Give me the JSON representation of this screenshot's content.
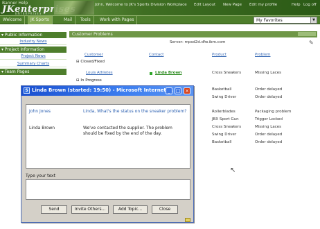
{
  "banner": {
    "logo_top": "Banner Help",
    "logo": "JKenterprises",
    "logo_sub": "ENTERPRISES",
    "welcome": "John, Welcome to JK's Sports Division Workplace",
    "links": [
      "Edit Layout",
      "New Page",
      "Edit my profile",
      "Help",
      "Log off"
    ]
  },
  "nav": {
    "tabs": [
      "Welcome",
      "JK Sports",
      "Mail",
      "Tools",
      "Work with Pages"
    ],
    "active_index": 1,
    "favorites": "My Favorites"
  },
  "sidebar": {
    "sections": [
      {
        "title": "Public Information",
        "items": [
          "Industry News"
        ]
      },
      {
        "title": "Project Information",
        "items": [
          "Project News",
          "Summary Charts"
        ]
      },
      {
        "title": "Team Pages",
        "items": []
      }
    ]
  },
  "main": {
    "title": "Customer Problems",
    "server": "Server: mpsd2d.dfw.ibm.com",
    "columns": [
      "Customer",
      "Contact",
      "Product",
      "Problem"
    ],
    "groups": {
      "closed": "Closed/Fixed",
      "progress": "In Progress"
    },
    "rows": [
      {
        "customer": "Louis Athletes",
        "contact": "Linda Brown",
        "product": "Cross Sneakers",
        "problem": "Missing Laces"
      },
      {
        "customer": "",
        "contact": "",
        "product": "Basketball",
        "problem": "Order delayed"
      },
      {
        "customer": "",
        "contact": "",
        "product": "Swing Driver",
        "problem": "Order delayed"
      },
      {
        "customer": "",
        "contact": "",
        "product": "Rollerblades",
        "problem": "Packaging problem"
      },
      {
        "customer": "",
        "contact": "",
        "product": "JBX Sport Gun",
        "problem": "Trigger Locked"
      },
      {
        "customer": "",
        "contact": "",
        "product": "Cross Sneakers",
        "problem": "Missing Laces"
      },
      {
        "customer": "",
        "contact": "",
        "product": "Swing Driver",
        "problem": "Order delayed"
      },
      {
        "customer": "",
        "contact": "",
        "product": "Basketball",
        "problem": "Order delayed"
      }
    ]
  },
  "dialog": {
    "title": "Linda Brown (started: 19:50) - Microsoft Internet ...",
    "messages": [
      {
        "speaker": "John Jones",
        "text": "Linda, What's the status on the sneaker problem?"
      },
      {
        "speaker": "Linda Brown",
        "text": "We've contacted the supplier. The problem should be fixed by the end of the day."
      }
    ],
    "type_label": "Type your text",
    "buttons": [
      "Send",
      "Invite Others...",
      "Add Topic...",
      "Close"
    ]
  },
  "colors": {
    "accent": "#4e7e2c",
    "title_bar": "#1a4fcf",
    "link": "#3a6bb5",
    "online": "#2fa62a"
  }
}
